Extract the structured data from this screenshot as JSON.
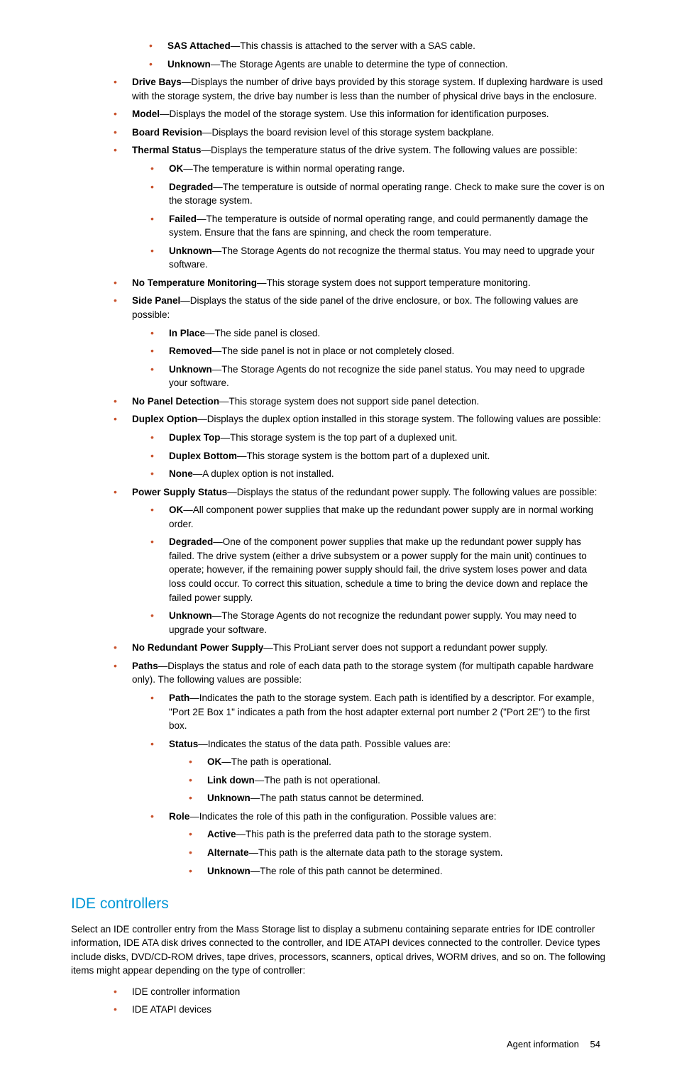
{
  "l2_intro": [
    {
      "term": "SAS Attached",
      "desc": "—This chassis is attached to the server with a SAS cable."
    },
    {
      "term": "Unknown",
      "desc": "—The Storage Agents are unable to determine the type of connection."
    }
  ],
  "items": [
    {
      "term": "Drive Bays",
      "desc": "—Displays the number of drive bays provided by this storage system. If duplexing hardware is used with the storage system, the drive bay number is less than the number of physical drive bays in the enclosure."
    },
    {
      "term": "Model",
      "desc": "—Displays the model of the storage system. Use this information for identification purposes."
    },
    {
      "term": "Board Revision",
      "desc": "—Displays the board revision level of this storage system backplane."
    },
    {
      "term": "Thermal Status",
      "desc": "—Displays the temperature status of the drive system. The following values are possible:",
      "children": [
        {
          "term": "OK",
          "desc": "—The temperature is within normal operating range."
        },
        {
          "term": "Degraded",
          "desc": "—The temperature is outside of normal operating range. Check to make sure the cover is on the storage system."
        },
        {
          "term": "Failed",
          "desc": "—The temperature is outside of normal operating range, and could permanently damage the system. Ensure that the fans are spinning, and check the room temperature."
        },
        {
          "term": "Unknown",
          "desc": "—The Storage Agents do not recognize the thermal status. You may need to upgrade your software."
        }
      ]
    },
    {
      "term": "No Temperature Monitoring",
      "desc": "—This storage system does not support temperature monitoring."
    },
    {
      "term": "Side Panel",
      "desc": "—Displays the status of the side panel of the drive enclosure, or box. The following values are possible:",
      "children": [
        {
          "term": "In Place",
          "desc": "—The side panel is closed."
        },
        {
          "term": "Removed",
          "desc": "—The side panel is not in place or not completely closed."
        },
        {
          "term": "Unknown",
          "desc": "—The Storage Agents do not recognize the side panel status. You may need to upgrade your software."
        }
      ]
    },
    {
      "term": "No Panel Detection",
      "desc": "—This storage system does not support side panel detection."
    },
    {
      "term": "Duplex Option",
      "desc": "—Displays the duplex option installed in this storage system. The following values are possible:",
      "children": [
        {
          "term": "Duplex Top",
          "desc": "—This storage system is the top part of a duplexed unit."
        },
        {
          "term": "Duplex Bottom",
          "desc": "—This storage system is the bottom part of a duplexed unit."
        },
        {
          "term": "None",
          "desc": "—A duplex option is not installed."
        }
      ]
    },
    {
      "term": "Power Supply Status",
      "desc": "—Displays the status of the redundant power supply. The following values are possible:",
      "children": [
        {
          "term": "OK",
          "desc": "—All component power supplies that make up the redundant power supply are in normal working order."
        },
        {
          "term": "Degraded",
          "desc": "—One of the component power supplies that make up the redundant power supply has failed. The drive system (either a drive subsystem or a power supply for the main unit) continues to operate; however, if the remaining power supply should fail, the drive system loses power and data loss could occur. To correct this situation, schedule a time to bring the device down and replace the failed power supply."
        },
        {
          "term": "Unknown",
          "desc": "—The Storage Agents do not recognize the redundant power supply. You may need to upgrade your software."
        }
      ]
    },
    {
      "term": "No Redundant Power Supply",
      "desc": "—This ProLiant server does not support a redundant power supply."
    },
    {
      "term": "Paths",
      "desc": "—Displays the status and role of each data path to the storage system (for multipath capable hardware only). The following values are possible:",
      "children": [
        {
          "term": "Path",
          "desc": "—Indicates the path to the storage system. Each path is identified by a descriptor. For example, \"Port 2E Box 1\" indicates a path from the host adapter external port number 2 (\"Port 2E\") to the first box."
        },
        {
          "term": "Status",
          "desc": "—Indicates the status of the data path. Possible values are:",
          "children": [
            {
              "term": "OK",
              "desc": "—The path is operational."
            },
            {
              "term": "Link down",
              "desc": "—The path is not operational."
            },
            {
              "term": "Unknown",
              "desc": "—The path status cannot be determined."
            }
          ]
        },
        {
          "term": "Role",
          "desc": "—Indicates the role of this path in the configuration. Possible values are:",
          "children": [
            {
              "term": "Active",
              "desc": "—This path is the preferred data path to the storage system."
            },
            {
              "term": "Alternate",
              "desc": "—This path is the alternate data path to the storage system."
            },
            {
              "term": "Unknown",
              "desc": "—The role of this path cannot be determined."
            }
          ]
        }
      ]
    }
  ],
  "section": {
    "heading": "IDE controllers",
    "paragraph": "Select an IDE controller entry from the Mass Storage list to display a submenu containing separate entries for IDE controller information, IDE ATA disk drives connected to the controller, and IDE ATAPI devices connected to the controller. Device types include disks, DVD/CD-ROM drives, tape drives, processors, scanners, optical drives, WORM drives, and so on. The following items might appear depending on the type of controller:",
    "bullets": [
      "IDE controller information",
      "IDE ATAPI devices"
    ]
  },
  "footer": {
    "label": "Agent information",
    "page": "54"
  }
}
